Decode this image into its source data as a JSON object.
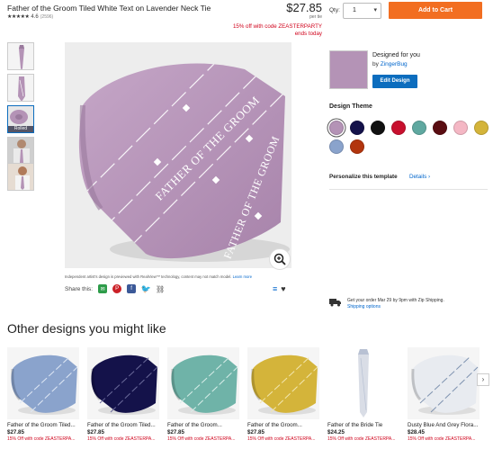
{
  "product": {
    "title": "Father of the Groom Tiled White Text on Lavender Neck Tie",
    "stars": "★★★★★",
    "rating": "4.6",
    "review_count": "(2596)",
    "price": "$27.85",
    "per_label": "per tie",
    "promo_line1": "15% off with code ZEASTERPARTY",
    "promo_line2": "ends today"
  },
  "purchase": {
    "qty_label": "Qty:",
    "qty_value": "1",
    "add_to_cart": "Add to Cart"
  },
  "thumbnails": {
    "rolled_label": "Rolled"
  },
  "tie_text": "FATHER OF THE GROOM",
  "disclaimer": {
    "text": "Independent artist's design is previewed with RealView™ technology, content may not match model.",
    "link": "Learn more"
  },
  "share": {
    "label": "Share this:"
  },
  "designer": {
    "designed_for": "Designed for you",
    "by": "by",
    "name": "ZingerBug",
    "edit_button": "Edit Design"
  },
  "design_theme": {
    "heading": "Design Theme",
    "colors": [
      "#b493b6",
      "#14124a",
      "#111111",
      "#c8102e",
      "#5fa8a0",
      "#5a0d12",
      "#f4b7c4",
      "#d4b43a",
      "#8aa3cc",
      "#b2350e"
    ]
  },
  "personalize": {
    "label": "Personalize this template",
    "details": "Details ›"
  },
  "shipping": {
    "line1": "Get your order Mar 29 by 9pm with Zip Shipping.",
    "line2": "Shipping options"
  },
  "recommendations": {
    "heading": "Other designs you might like",
    "items": [
      {
        "title": "Father of the Groom Tiled...",
        "price": "$27.85",
        "promo": "15% Off with code ZEASTERPA...",
        "color": "#8aa3cc",
        "stripe": "#dfe8f5"
      },
      {
        "title": "Father of the Groom Tiled...",
        "price": "$27.85",
        "promo": "15% Off with code ZEASTERPA...",
        "color": "#14124a",
        "stripe": "#6a6a9a"
      },
      {
        "title": "Father of the Groom...",
        "price": "$27.85",
        "promo": "15% Off with code ZEASTERPA...",
        "color": "#6fb3a8",
        "stripe": "#d8eee9"
      },
      {
        "title": "Father of the Groom...",
        "price": "$27.85",
        "promo": "15% Off with code ZEASTERPA...",
        "color": "#d4b43a",
        "stripe": "#f3e7b0"
      },
      {
        "title": "Father of the Bride Tie",
        "price": "$24.25",
        "promo": "15% Off with code ZEASTERPA...",
        "color": "#d9dde6",
        "stripe": "#b8c1d3"
      },
      {
        "title": "Dusty Blue And Grey Flora...",
        "price": "$28.45",
        "promo": "15% Off with code ZEASTERPA...",
        "color": "#e8ebf0",
        "stripe": "#7f93b0"
      }
    ],
    "next": "›"
  },
  "icons": {
    "email": "email-icon",
    "pinterest": "pinterest-icon",
    "facebook": "facebook-icon",
    "twitter": "twitter-icon",
    "link": "link-icon",
    "zoom": "zoom-icon",
    "heart": "heart-icon",
    "truck": "truck-icon"
  },
  "colors": {
    "accent": "#f26e21",
    "edit": "#0c6dbe",
    "promo": "#d0021b",
    "tie": "#b493b6"
  }
}
